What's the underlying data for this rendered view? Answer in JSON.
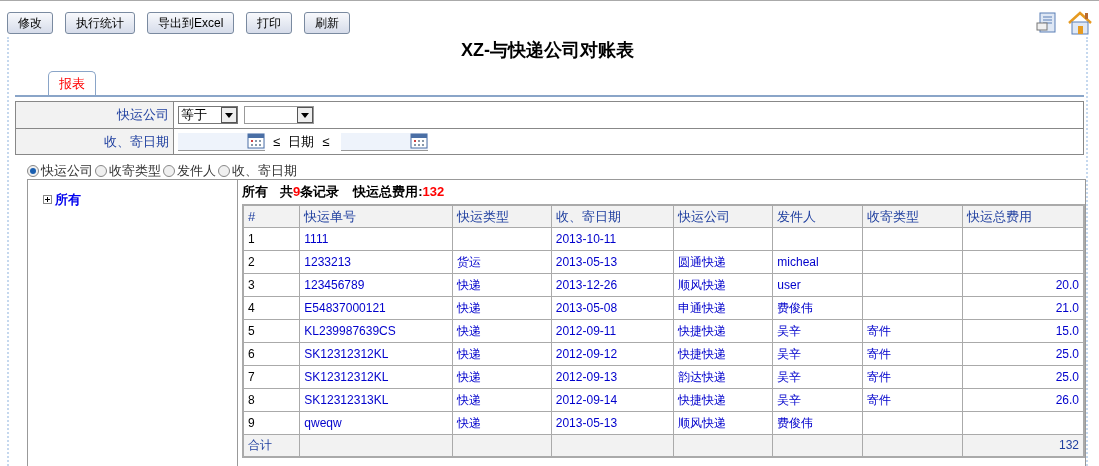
{
  "toolbar": {
    "buttons": [
      "修改",
      "执行统计",
      "导出到Excel",
      "打印",
      "刷新"
    ]
  },
  "title": "XZ-与快递公司对账表",
  "tabs": [
    {
      "label": "报表",
      "selected": true
    }
  ],
  "filters": [
    {
      "kind": "select",
      "label": "快运公司",
      "operator": "等于"
    },
    {
      "kind": "daterange",
      "label": "收、寄日期",
      "middle_left": "≤",
      "middle": "日期",
      "middle_right": "≤"
    }
  ],
  "group_by": [
    {
      "label": "快运公司",
      "selected": true
    },
    {
      "label": "收寄类型",
      "selected": false
    },
    {
      "label": "发件人",
      "selected": false
    },
    {
      "label": "收、寄日期",
      "selected": false
    }
  ],
  "tree": [
    {
      "label": "所有",
      "expanded": false
    }
  ],
  "summary": {
    "scope": "所有",
    "count_prefix": "共",
    "count": "9",
    "count_suffix": "条记录",
    "cost_label": "快运总费用:",
    "cost": "132"
  },
  "table": {
    "columns": [
      "#",
      "快运单号",
      "快运类型",
      "收、寄日期",
      "快运公司",
      "发件人",
      "收寄类型",
      "快运总费用"
    ],
    "rows": [
      {
        "index": "1",
        "number": "1111",
        "date": "2013-10-11"
      },
      {
        "index": "2",
        "number": "1233213",
        "type": "货运",
        "date": "2013-05-13",
        "company": "圆通快递",
        "sender": "micheal"
      },
      {
        "index": "3",
        "number": "123456789",
        "type": "快递",
        "date": "2013-12-26",
        "company": "顺风快递",
        "sender": "user",
        "cost": "20.0"
      },
      {
        "index": "4",
        "number": "E54837000121",
        "type": "快递",
        "date": "2013-05-08",
        "company": "申通快递",
        "sender": "费俊伟",
        "cost": "21.0"
      },
      {
        "index": "5",
        "number": "KL239987639CS",
        "type": "快递",
        "date": "2012-09-11",
        "company": "快捷快递",
        "sender": "吴辛",
        "mail_type": "寄件",
        "cost": "15.0"
      },
      {
        "index": "6",
        "number": "SK12312312KL",
        "type": "快递",
        "date": "2012-09-12",
        "company": "快捷快递",
        "sender": "吴辛",
        "mail_type": "寄件",
        "cost": "25.0"
      },
      {
        "index": "7",
        "number": "SK12312312KL",
        "type": "快递",
        "date": "2012-09-13",
        "company": "韵达快递",
        "sender": "吴辛",
        "mail_type": "寄件",
        "cost": "25.0"
      },
      {
        "index": "8",
        "number": "SK12312313KL",
        "type": "快递",
        "date": "2012-09-14",
        "company": "快捷快递",
        "sender": "吴辛",
        "mail_type": "寄件",
        "cost": "26.0"
      },
      {
        "index": "9",
        "number": "qweqw",
        "type": "快递",
        "date": "2013-05-13",
        "company": "顺风快递",
        "sender": "费俊伟"
      }
    ],
    "total_row": {
      "label": "合计",
      "cost": "132"
    }
  }
}
